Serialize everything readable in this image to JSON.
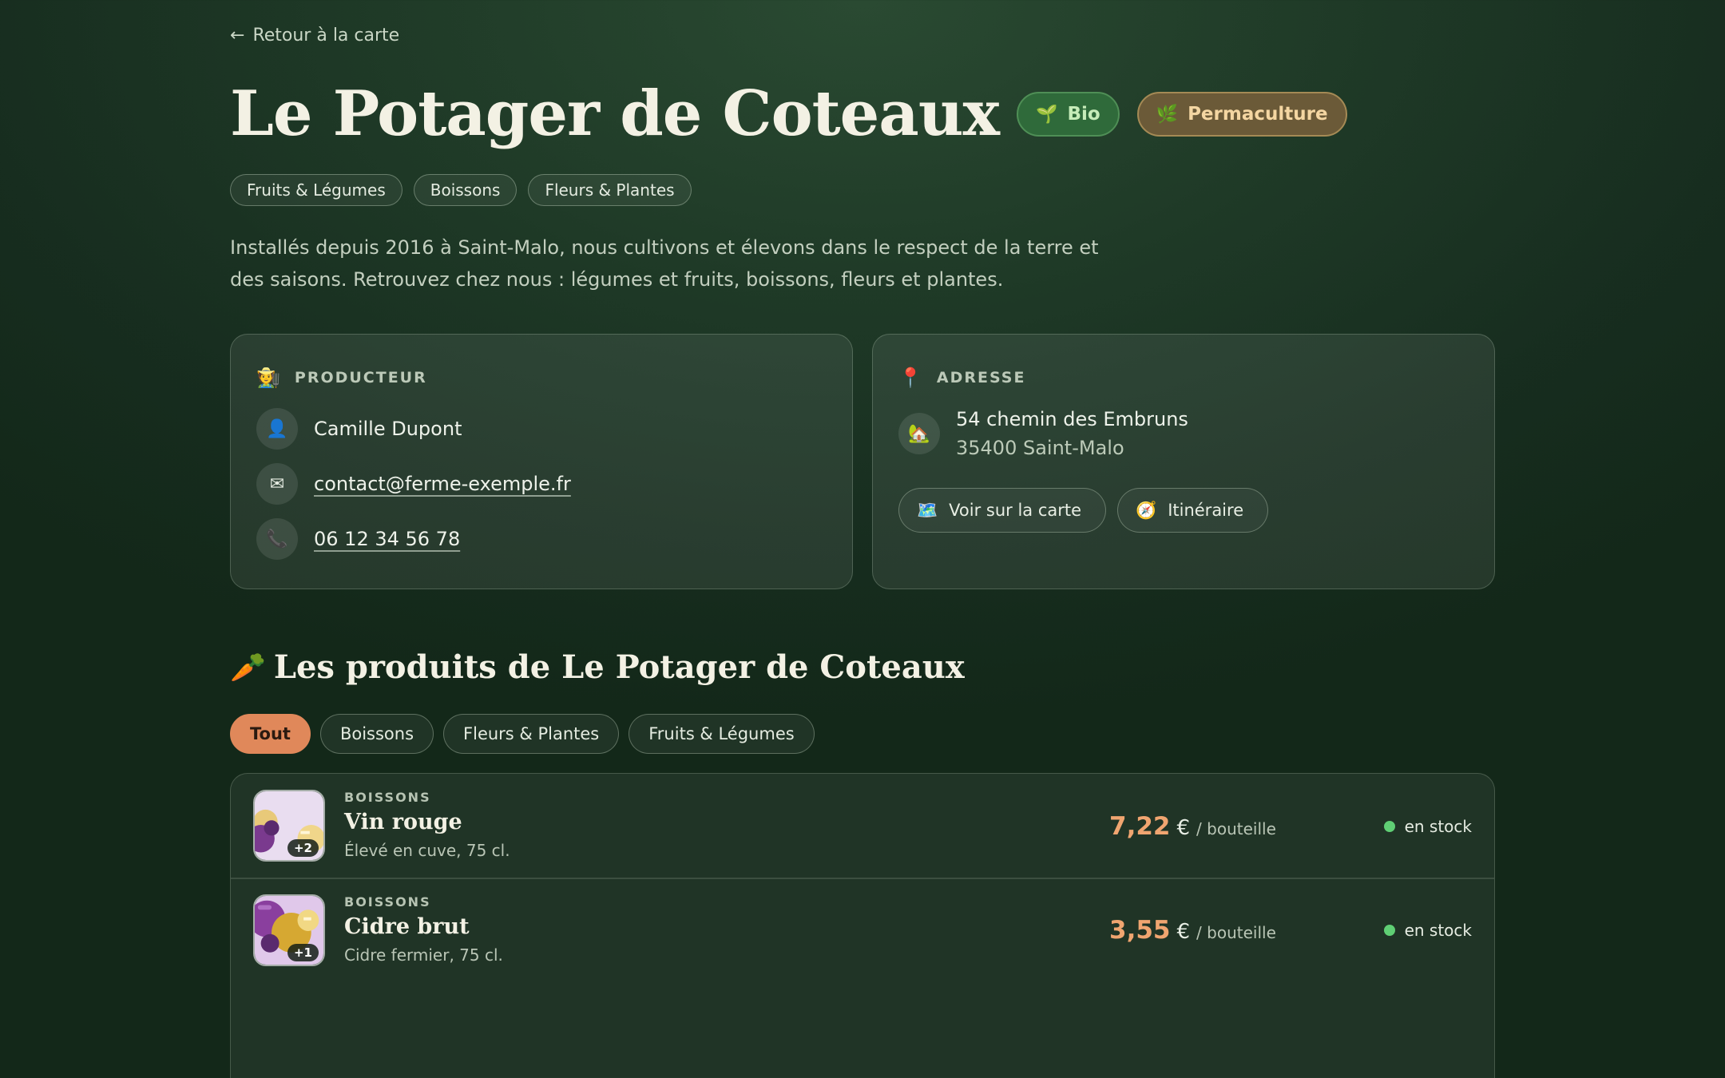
{
  "nav": {
    "back_label": "Retour à la carte"
  },
  "farm": {
    "name": "Le Potager de Coteaux",
    "labels": [
      {
        "icon": "seedling-icon",
        "text": "Bio"
      },
      {
        "icon": "herb-icon",
        "text": "Permaculture"
      }
    ],
    "categories": [
      "Fruits & Légumes",
      "Boissons",
      "Fleurs & Plantes"
    ],
    "description": "Installés depuis 2016 à Saint-Malo, nous cultivons et élevons dans le respect de la terre et des saisons. Retrouvez chez nous : légumes et fruits, boissons, fleurs et plantes."
  },
  "producer": {
    "heading": "PRODUCTEUR",
    "name": "Camille Dupont",
    "email": "contact@ferme-exemple.fr",
    "phone": "06 12 34 56 78"
  },
  "address": {
    "heading": "ADRESSE",
    "line1": "54 chemin des Embruns",
    "line2": "35400 Saint-Malo",
    "map_button": "Voir sur la carte",
    "route_button": "Itinéraire"
  },
  "products": {
    "title": "Les produits de Le Potager de Coteaux",
    "filters": [
      "Tout",
      "Boissons",
      "Fleurs & Plantes",
      "Fruits & Légumes"
    ],
    "active_filter": "Tout",
    "items": [
      {
        "category": "BOISSONS",
        "name": "Vin rouge",
        "description": "Élevé en cuve, 75 cl.",
        "price": "7,22",
        "currency": "€",
        "unit": "/ bouteille",
        "stock": "en stock",
        "extra_images": "+2"
      },
      {
        "category": "BOISSONS",
        "name": "Cidre brut",
        "description": "Cidre fermier, 75 cl.",
        "price": "3,55",
        "currency": "€",
        "unit": "/ bouteille",
        "stock": "en stock",
        "extra_images": "+1"
      }
    ]
  },
  "colors": {
    "accent": "#e0885a",
    "price": "#f0a570",
    "in_stock": "#5fcf74",
    "bio_badge": "#2f6a3a",
    "permaculture_badge": "#6b5a38"
  }
}
